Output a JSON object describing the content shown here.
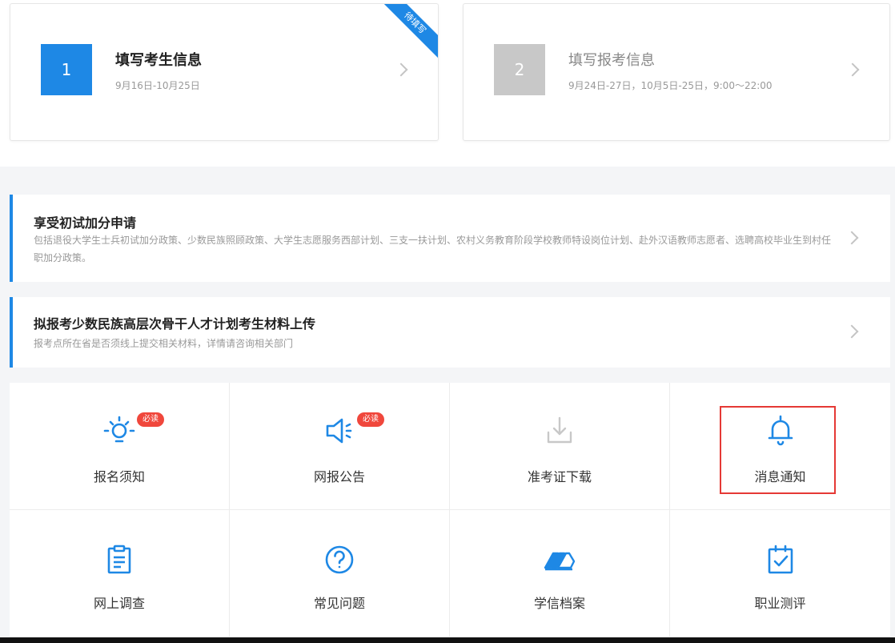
{
  "steps": [
    {
      "number": "1",
      "title": "填写考生信息",
      "subtitle": "9月16日-10月25日",
      "ribbon": "待填写"
    },
    {
      "number": "2",
      "title": "填写报考信息",
      "subtitle": "9月24日-27日，10月5日-25日，9:00～22:00"
    }
  ],
  "notices": [
    {
      "title": "享受初试加分申请",
      "desc": "包括退役大学生士兵初试加分政策、少数民族照顾政策、大学生志愿服务西部计划、三支一扶计划、农村义务教育阶段学校教师特设岗位计划、赴外汉语教师志愿者、选聘高校毕业生到村任职加分政策。"
    },
    {
      "title": "拟报考少数民族高层次骨干人才计划考生材料上传",
      "desc": "报考点所在省是否须线上提交相关材料，详情请咨询相关部门"
    }
  ],
  "grid": [
    {
      "label": "报名须知",
      "icon": "lightbulb-icon",
      "badge": "必读"
    },
    {
      "label": "网报公告",
      "icon": "megaphone-icon",
      "badge": "必读"
    },
    {
      "label": "准考证下载",
      "icon": "download-icon"
    },
    {
      "label": "消息通知",
      "icon": "bell-icon"
    },
    {
      "label": "网上调查",
      "icon": "clipboard-icon"
    },
    {
      "label": "常见问题",
      "icon": "question-icon"
    },
    {
      "label": "学信档案",
      "icon": "archive-icon"
    },
    {
      "label": "职业测评",
      "icon": "checklist-icon"
    }
  ],
  "colors": {
    "primary": "#1e88e5",
    "badge": "#f0473c",
    "highlight": "#e53935",
    "disabled": "#c8c8c8"
  }
}
